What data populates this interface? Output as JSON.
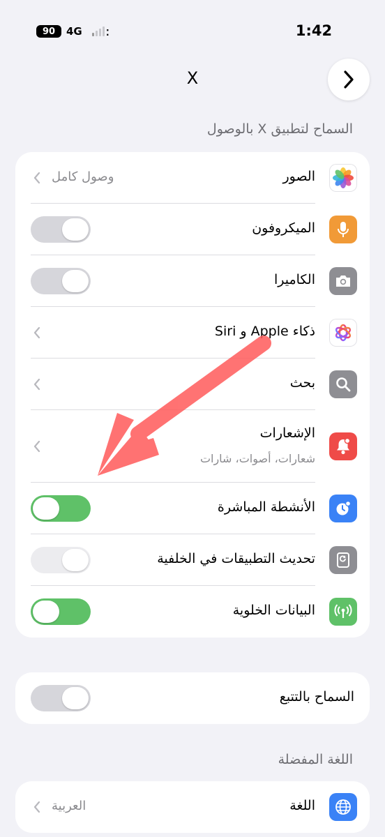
{
  "status_bar": {
    "time": "1:42",
    "battery": "90",
    "network": "4G"
  },
  "nav": {
    "title": "X"
  },
  "permissions": {
    "header": "السماح لتطبيق X بالوصول",
    "rows": [
      {
        "label": "الصور",
        "value": "وصول كامل",
        "icon": "photos-icon"
      },
      {
        "label": "الميكروفون",
        "toggle": "off",
        "icon": "microphone-icon"
      },
      {
        "label": "الكاميرا",
        "toggle": "off",
        "icon": "camera-icon"
      },
      {
        "label": "ذكاء Apple و Siri",
        "icon": "apple-intelligence-icon"
      },
      {
        "label": "بحث",
        "icon": "search-icon"
      },
      {
        "label": "الإشعارات",
        "sublabel": "شعارات، أصوات، شارات",
        "icon": "notifications-icon"
      },
      {
        "label": "الأنشطة المباشرة",
        "toggle": "on",
        "icon": "live-activities-icon"
      },
      {
        "label": "تحديث التطبيقات في الخلفية",
        "toggle": "disabled",
        "icon": "background-refresh-icon"
      },
      {
        "label": "البيانات الخلوية",
        "toggle": "on",
        "icon": "cellular-icon"
      }
    ]
  },
  "tracking": {
    "label": "السماح بالتتبع",
    "toggle": "off"
  },
  "language": {
    "header": "اللغة المفضلة",
    "label": "اللغة",
    "value": "العربية",
    "icon": "globe-icon"
  },
  "colors": {
    "toggle_on": "#5fc168",
    "toggle_off": "#d6d6db",
    "annotation_arrow": "#ff5a5a"
  }
}
